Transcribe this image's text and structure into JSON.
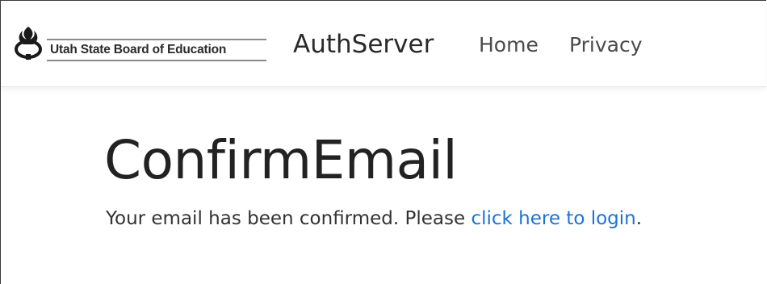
{
  "header": {
    "logo_text": "Utah State Board of Education",
    "brand_name": "AuthServer",
    "nav": [
      {
        "label": "Home"
      },
      {
        "label": "Privacy"
      }
    ]
  },
  "main": {
    "title": "ConfirmEmail",
    "message_prefix": "Your email has been confirmed. Please ",
    "login_link_label": "click here to login",
    "message_suffix": "."
  },
  "colors": {
    "link": "#1b73d6",
    "text": "#222222",
    "nav_text": "#4a4a4a"
  }
}
